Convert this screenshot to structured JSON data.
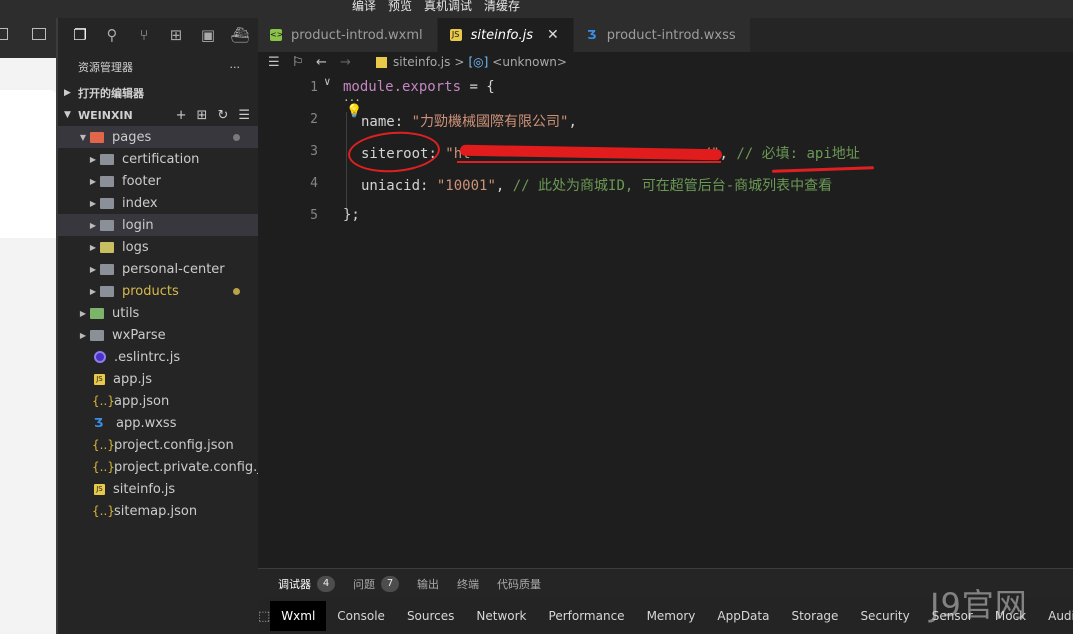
{
  "toolbar": {
    "items": [
      "编译",
      "预览",
      "真机调试",
      "清缓存"
    ]
  },
  "explorer": {
    "title": "资源管理器",
    "more": "···",
    "open_editors": "打开的编辑器",
    "workspace": "WEINXIN",
    "tree": [
      {
        "label": "pages"
      },
      {
        "label": "certification"
      },
      {
        "label": "footer"
      },
      {
        "label": "index"
      },
      {
        "label": "login"
      },
      {
        "label": "logs"
      },
      {
        "label": "personal-center"
      },
      {
        "label": "products"
      },
      {
        "label": "utils"
      },
      {
        "label": "wxParse"
      },
      {
        "label": ".eslintrc.js"
      },
      {
        "label": "app.js"
      },
      {
        "label": "app.json"
      },
      {
        "label": "app.wxss"
      },
      {
        "label": "project.config.json"
      },
      {
        "label": "project.private.config.js..."
      },
      {
        "label": "siteinfo.js"
      },
      {
        "label": "sitemap.json"
      }
    ]
  },
  "tabs": [
    {
      "label": "product-introd.wxml"
    },
    {
      "label": "siteinfo.js",
      "close": "✕"
    },
    {
      "label": "product-introd.wxss"
    }
  ],
  "breadcrumb": {
    "file": "siteinfo.js",
    "sep": ">",
    "symbol": "<unknown>"
  },
  "code": {
    "lines": [
      "1",
      "2",
      "3",
      "4",
      "5"
    ],
    "l1_a": "module.exports",
    "l1_b": " = {",
    "l2_key": "name",
    "l2_colon": ": ",
    "l2_val": "\"力勁機械國際有限公司\"",
    "l2_end": ",",
    "l3_key": "siteroot",
    "l3_colon": ": ",
    "l3_val": "\"ht",
    "l3_val2": "/\"",
    "l3_end": ", ",
    "l3_cmt": "// 必填: api地址",
    "l4_key": "uniacid",
    "l4_colon": ": ",
    "l4_val": "\"10001\"",
    "l4_end": ", ",
    "l4_cmt": "// 此处为商城ID, 可在超管后台-商城列表中查看",
    "l5": "};"
  },
  "panel": {
    "tabs": [
      {
        "label": "调试器",
        "badge": "4"
      },
      {
        "label": "问题",
        "badge": "7"
      },
      {
        "label": "输出"
      },
      {
        "label": "终端"
      },
      {
        "label": "代码质量"
      }
    ]
  },
  "devtools": {
    "tabs": [
      "Wxml",
      "Console",
      "Sources",
      "Network",
      "Performance",
      "Memory",
      "AppData",
      "Storage",
      "Security",
      "Sensor",
      "Mock",
      "Audits"
    ]
  },
  "watermark": "J9官网",
  "colors": {
    "accent": "#e02020",
    "editor_bg": "#1e1e1e",
    "sidebar_bg": "#252526"
  }
}
